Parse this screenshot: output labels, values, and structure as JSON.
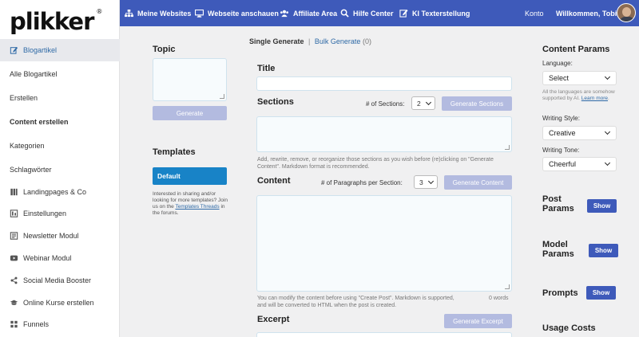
{
  "brand": {
    "logo_text": "plikker",
    "registered": "®"
  },
  "topnav": {
    "items": [
      {
        "label": "Meine Websites",
        "icon": "sitemap-icon"
      },
      {
        "label": "Webseite anschauen",
        "icon": "monitor-icon"
      },
      {
        "label": "Affiliate Area",
        "icon": "people-icon"
      },
      {
        "label": "Hilfe Center",
        "icon": "search-icon"
      },
      {
        "label": "KI Texterstellung",
        "icon": "edit-icon"
      }
    ],
    "account_label": "Konto",
    "welcome_label": "Willkommen, Tobias"
  },
  "sidebar": {
    "items": [
      {
        "label": "Blogartikel",
        "icon": "edit-icon",
        "active": true
      },
      {
        "label": "Alle Blogartikel"
      },
      {
        "label": "Erstellen"
      },
      {
        "label": "Content erstellen",
        "bold": true
      },
      {
        "label": "Kategorien"
      },
      {
        "label": "Schlagwörter"
      },
      {
        "label": "Landingpages & Co",
        "icon": "pages-icon"
      },
      {
        "label": "Einstellungen",
        "icon": "settings-icon"
      },
      {
        "label": "Newsletter Modul",
        "icon": "newsletter-icon"
      },
      {
        "label": "Webinar Modul",
        "icon": "video-icon"
      },
      {
        "label": "Social Media Booster",
        "icon": "share-icon"
      },
      {
        "label": "Online Kurse erstellen",
        "icon": "graduation-icon"
      },
      {
        "label": "Funnels",
        "icon": "grid-icon"
      }
    ]
  },
  "left_panel": {
    "topic_heading": "Topic",
    "generate_label": "Generate",
    "templates_heading": "Templates",
    "default_template_label": "Default",
    "note_text": "Interested in sharing and/or looking for more templates? Join us on the",
    "note_link": "Templates Threads",
    "note_suffix": "in the forums."
  },
  "tabs": {
    "single_label": "Single Generate",
    "separator": "|",
    "bulk_label": "Bulk Generate",
    "bulk_count": "(0)"
  },
  "editor": {
    "title_label": "Title",
    "title_value": "",
    "sections_label": "Sections",
    "sections_count_label": "# of Sections:",
    "sections_count_value": "2",
    "generate_sections_label": "Generate Sections",
    "sections_hint": "Add, rewrite, remove, or reorganize those sections as you wish before (re)clicking on \"Generate Content\". Markdown format is recommended.",
    "content_label": "Content",
    "paragraphs_label": "# of Paragraphs per Section:",
    "paragraphs_value": "3",
    "generate_content_label": "Generate Content",
    "content_hint": "You can modify the content before using \"Create Post\". Markdown is supported, and will be converted to HTML when the post is created.",
    "word_count": "0 words",
    "excerpt_label": "Excerpt",
    "generate_excerpt_label": "Generate Excerpt"
  },
  "right_panel": {
    "content_params_heading": "Content Params",
    "language_label": "Language:",
    "language_value": "Select",
    "language_hint": "All the languages are somehow supported by AI.",
    "language_hint_link": "Learn more",
    "writing_style_label": "Writing Style:",
    "writing_style_value": "Creative",
    "writing_tone_label": "Writing Tone:",
    "writing_tone_value": "Cheerful",
    "post_params_line1": "Post",
    "post_params_line2": "Params",
    "model_params_line1": "Model",
    "model_params_line2": "Params",
    "prompts_heading": "Prompts",
    "show_label": "Show",
    "usage_costs_heading": "Usage Costs"
  },
  "colors": {
    "topbar": "#3e5aba",
    "default_button": "#1883c7",
    "disabled_button": "#b3bbe0",
    "link": "#2f6aa6"
  }
}
